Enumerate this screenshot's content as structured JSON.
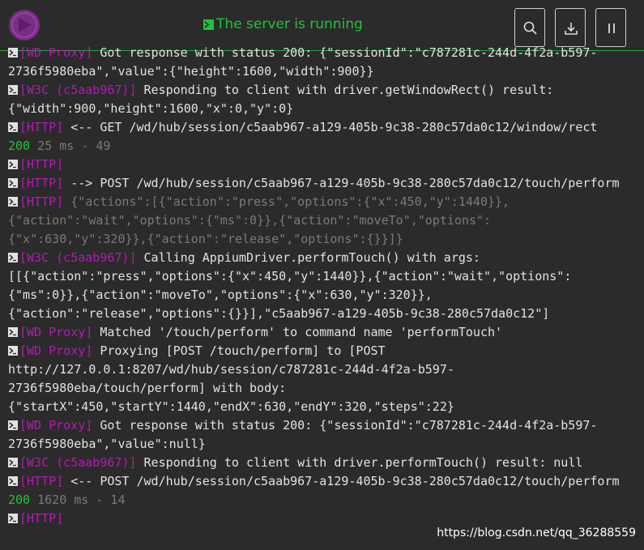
{
  "header": {
    "status_text": "The server is running",
    "buttons": [
      {
        "name": "search-button",
        "icon": "search-icon"
      },
      {
        "name": "download-button",
        "icon": "download-icon"
      },
      {
        "name": "pause-button",
        "icon": "pause-icon"
      }
    ]
  },
  "colors": {
    "accent_green": "#21c23a",
    "tag_magenta": "#b41ab4",
    "logo_purple": "#7a2d86",
    "background": "#2b2b2b"
  },
  "log": {
    "lines": [
      {
        "arrow": true,
        "tag": "[WD Proxy]",
        "text": " Got response with status 200: {\"sessionId\":\"c787281c-244d-4f2a-b597-"
      },
      {
        "arrow": false,
        "tag": "",
        "text": "2736f5980eba\",\"value\":{\"height\":1600,\"width\":900}}"
      },
      {
        "arrow": true,
        "tag": "[W3C (c5aab967)]",
        "text": " Responding to client with driver.getWindowRect() result:"
      },
      {
        "arrow": false,
        "tag": "",
        "text": "{\"width\":900,\"height\":1600,\"x\":0,\"y\":0}"
      },
      {
        "arrow": true,
        "tag": "[HTTP]",
        "text": " <-- GET /wd/hub/session/c5aab967-a129-405b-9c38-280c57da0c12/window/rect"
      },
      {
        "arrow": false,
        "tag": "",
        "code": "200",
        "dim": " 25 ms - 49"
      },
      {
        "arrow": true,
        "tag": "[HTTP]",
        "text": ""
      },
      {
        "arrow": true,
        "tag": "[HTTP]",
        "text": " --> POST /wd/hub/session/c5aab967-a129-405b-9c38-280c57da0c12/touch/perform"
      },
      {
        "arrow": true,
        "tag": "[HTTP]",
        "dim": " {\"actions\":[{\"action\":\"press\",\"options\":{\"x\":450,\"y\":1440}},"
      },
      {
        "arrow": false,
        "tag": "",
        "dim": "{\"action\":\"wait\",\"options\":{\"ms\":0}},{\"action\":\"moveTo\",\"options\":"
      },
      {
        "arrow": false,
        "tag": "",
        "dim": "{\"x\":630,\"y\":320}},{\"action\":\"release\",\"options\":{}}]}"
      },
      {
        "arrow": true,
        "tag": "[W3C (c5aab967)]",
        "text": " Calling AppiumDriver.performTouch() with args:"
      },
      {
        "arrow": false,
        "tag": "",
        "text": "[[{\"action\":\"press\",\"options\":{\"x\":450,\"y\":1440}},{\"action\":\"wait\",\"options\":"
      },
      {
        "arrow": false,
        "tag": "",
        "text": "{\"ms\":0}},{\"action\":\"moveTo\",\"options\":{\"x\":630,\"y\":320}},"
      },
      {
        "arrow": false,
        "tag": "",
        "text": "{\"action\":\"release\",\"options\":{}}],\"c5aab967-a129-405b-9c38-280c57da0c12\"]"
      },
      {
        "arrow": true,
        "tag": "[WD Proxy]",
        "text": " Matched '/touch/perform' to command name 'performTouch'"
      },
      {
        "arrow": true,
        "tag": "[WD Proxy]",
        "text": " Proxying [POST /touch/perform] to [POST"
      },
      {
        "arrow": false,
        "tag": "",
        "text": "http://127.0.0.1:8207/wd/hub/session/c787281c-244d-4f2a-b597-"
      },
      {
        "arrow": false,
        "tag": "",
        "text": "2736f5980eba/touch/perform] with body:"
      },
      {
        "arrow": false,
        "tag": "",
        "text": "{\"startX\":450,\"startY\":1440,\"endX\":630,\"endY\":320,\"steps\":22}"
      },
      {
        "arrow": true,
        "tag": "[WD Proxy]",
        "text": " Got response with status 200: {\"sessionId\":\"c787281c-244d-4f2a-b597-"
      },
      {
        "arrow": false,
        "tag": "",
        "text": "2736f5980eba\",\"value\":null}"
      },
      {
        "arrow": true,
        "tag": "[W3C (c5aab967)]",
        "text": " Responding to client with driver.performTouch() result: null"
      },
      {
        "arrow": true,
        "tag": "[HTTP]",
        "text": " <-- POST /wd/hub/session/c5aab967-a129-405b-9c38-280c57da0c12/touch/perform"
      },
      {
        "arrow": false,
        "tag": "",
        "code": "200",
        "dim": " 1620 ms - 14"
      },
      {
        "arrow": true,
        "tag": "[HTTP]",
        "text": ""
      }
    ]
  },
  "watermark": "https://blog.csdn.net/qq_36288559"
}
